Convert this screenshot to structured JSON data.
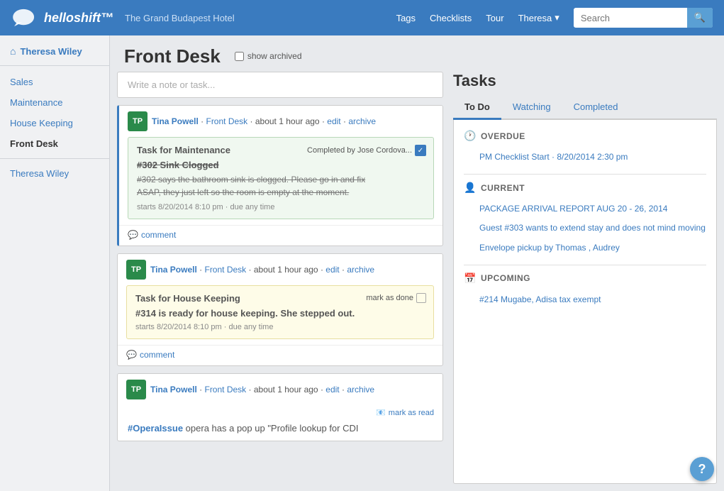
{
  "app": {
    "logo_text": "helloshift™",
    "hotel_name": "The Grand Budapest Hotel"
  },
  "nav": {
    "links": [
      "Tags",
      "Checklists",
      "Tour"
    ],
    "user": "Theresa",
    "search_placeholder": "Search"
  },
  "sidebar": {
    "user_label": "Theresa Wiley",
    "items": [
      {
        "label": "Sales",
        "id": "sales"
      },
      {
        "label": "Maintenance",
        "id": "maintenance"
      },
      {
        "label": "House Keeping",
        "id": "housekeeping"
      },
      {
        "label": "Front Desk",
        "id": "frontdesk",
        "active": true
      }
    ],
    "person": "Theresa Wiley"
  },
  "main": {
    "title": "Front Desk",
    "show_archived_label": "show archived",
    "write_placeholder": "Write a note or task..."
  },
  "feed": {
    "cards": [
      {
        "avatar": "TP",
        "author": "Tina Powell",
        "dept": "Front Desk",
        "time": "about 1 hour ago",
        "edit": "edit",
        "archive": "archive",
        "task_label": "Task for Maintenance",
        "completed_by": "Completed by Jose Cordova...",
        "task_title": "#302 Sink Clogged",
        "task_body_line1": "#302 says the bathroom sink is clogged. Please go in and fix",
        "task_body_line2": "ASAP, they just left so the room is empty at the moment.",
        "task_time": "starts 8/20/2014 8:10 pm · due any time",
        "comment_label": "comment",
        "type": "maintenance"
      },
      {
        "avatar": "TP",
        "author": "Tina Powell",
        "dept": "Front Desk",
        "time": "about 1 hour ago",
        "edit": "edit",
        "archive": "archive",
        "task_label": "Task for House Keeping",
        "task_title": "#314 is ready for house keeping. She stepped out.",
        "task_time": "starts 8/20/2014 8:10 pm · due any time",
        "comment_label": "comment",
        "mark_done": "mark as done",
        "type": "housekeeping"
      },
      {
        "avatar": "TP",
        "author": "Tina Powell",
        "dept": "Front Desk",
        "time": "about 1 hour ago",
        "edit": "edit",
        "archive": "archive",
        "mark_as_read": "mark as read",
        "opera_issue": "#OperaIssue",
        "opera_body": " opera has a pop up \"Profile lookup for CDI",
        "type": "opera"
      }
    ]
  },
  "tasks": {
    "title": "Tasks",
    "tabs": [
      {
        "label": "To Do",
        "id": "todo",
        "active": true
      },
      {
        "label": "Watching",
        "id": "watching"
      },
      {
        "label": "Completed",
        "id": "completed"
      }
    ],
    "sections": [
      {
        "id": "overdue",
        "icon": "clock",
        "header": "OVERDUE",
        "items": [
          {
            "text": "PM Checklist Start · 8/20/2014 2:30 pm"
          }
        ]
      },
      {
        "id": "current",
        "icon": "person",
        "header": "CURRENT",
        "items": [
          {
            "text": "PACKAGE ARRIVAL REPORT AUG 20 - 26, 2014"
          },
          {
            "text": "Guest #303 wants to extend stay and does not mind moving"
          },
          {
            "text": "Envelope pickup by Thomas , Audrey"
          }
        ]
      },
      {
        "id": "upcoming",
        "icon": "calendar",
        "header": "UPCOMING",
        "items": [
          {
            "text": "#214 Mugabe, Adisa tax exempt"
          }
        ]
      }
    ]
  },
  "help": {
    "label": "?"
  }
}
